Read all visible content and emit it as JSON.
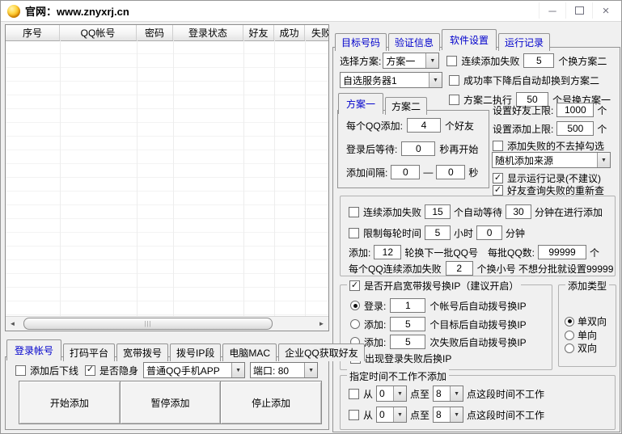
{
  "window": {
    "title": "官网：www.znyxrj.cn"
  },
  "icons": {
    "minimize": "─",
    "close": "×",
    "dropdown_arrow": "▼",
    "check": "✓",
    "scroll_left": "◄",
    "scroll_right": "►",
    "thumb_grip": "|||"
  },
  "colors": {
    "accent_blue": "#0000CC",
    "window_bg": "#F0F0F0",
    "titlebar_bg": "#FFFFFF"
  },
  "account_table": {
    "columns": [
      "序号",
      "QQ帐号",
      "密码",
      "登录状态",
      "好友",
      "成功",
      "失败"
    ]
  },
  "right_panel": {
    "tabs": [
      "目标号码",
      "验证信息",
      "软件设置",
      "运行记录"
    ],
    "active_tab": "软件设置",
    "plan_row": {
      "label": "选择方案:",
      "selected": "方案一",
      "checkbox": "连续添加失败",
      "value": "5",
      "suffix": "个换方案二"
    },
    "server_row": {
      "selected": "自选服务器1",
      "checkbox": "成功率下降后自动却换到方案二"
    },
    "plan2_row": {
      "checkbox": "方案二执行",
      "value": "50",
      "suffix": "个号换方案一"
    },
    "plan_tabs": [
      "方案一",
      "方案二"
    ],
    "active_plan_tab": "方案一",
    "plan_one": {
      "add_per_qq": {
        "label": "每个QQ添加:",
        "value": "4",
        "suffix": "个好友"
      },
      "wait_after_login": {
        "label": "登录后等待:",
        "value": "0",
        "suffix": "秒再开始"
      },
      "interval": {
        "label": "添加间隔:",
        "value1": "0",
        "separator": "—",
        "value2": "0",
        "suffix": "秒"
      }
    },
    "limits": {
      "friend_limit": {
        "label": "设置好友上限:",
        "value": "1000",
        "unit": "个"
      },
      "add_limit": {
        "label": "设置添加上限:",
        "value": "500",
        "unit": "个"
      },
      "keep_failed_checkbox": "添加失败的不去掉勾选",
      "source_selected": "随机添加来源",
      "show_log_checkbox": "显示运行记录(不建议)",
      "requery_checkbox": "好友查询失败的重新查"
    },
    "batch": {
      "fail_wait": {
        "checkbox": "连续添加失败",
        "value1": "15",
        "mid": "个自动等待",
        "value2": "30",
        "suffix": "分钟在进行添加"
      },
      "round_limit": {
        "checkbox": "限制每轮时间",
        "value1": "5",
        "mid": "小时",
        "value2": "0",
        "suffix": "分钟"
      },
      "rotate": {
        "label1": "添加:",
        "value1": "12",
        "label2": "轮换下一批QQ号",
        "label3": "每批QQ数:",
        "value2": "99999",
        "unit": "个"
      },
      "switch_fail": {
        "label": "每个QQ连续添加失败",
        "value": "2",
        "suffix": "个换小号 不想分批就设置99999"
      }
    },
    "redial": {
      "title": "是否开启宽带拨号换IP（建议开启）",
      "options": [
        {
          "label": "登录:",
          "value": "1",
          "suffix": "个帐号后自动拨号换IP"
        },
        {
          "label": "添加:",
          "value": "5",
          "suffix": "个目标后自动拨号换IP"
        },
        {
          "label": "添加:",
          "value": "5",
          "suffix": "次失败后自动拨号换IP"
        }
      ],
      "fail_ip_checkbox": "出现登录失败后换IP"
    },
    "add_type": {
      "title": "添加类型",
      "options": [
        "单双向",
        "单向",
        "双向"
      ],
      "selected": "单双向"
    },
    "schedule": {
      "title": "指定时间不工作不添加",
      "rows": [
        {
          "prefix": "从",
          "from": "0",
          "mid": "点至",
          "to": "8",
          "suffix": "点这段时间不工作"
        },
        {
          "prefix": "从",
          "from": "0",
          "mid": "点至",
          "to": "8",
          "suffix": "点这段时间不工作"
        }
      ]
    }
  },
  "bottom_panel": {
    "tabs": [
      "登录帐号",
      "打码平台",
      "宽带拨号",
      "拨号IP段",
      "电脑MAC",
      "企业QQ获取好友"
    ],
    "active_tab": "登录帐号",
    "offline_checkbox": "添加后下线",
    "invisible_checkbox": "是否隐身",
    "app_selected": "普通QQ手机APP",
    "port_selected": "端口: 80",
    "buttons": [
      "开始添加",
      "暂停添加",
      "停止添加"
    ]
  }
}
